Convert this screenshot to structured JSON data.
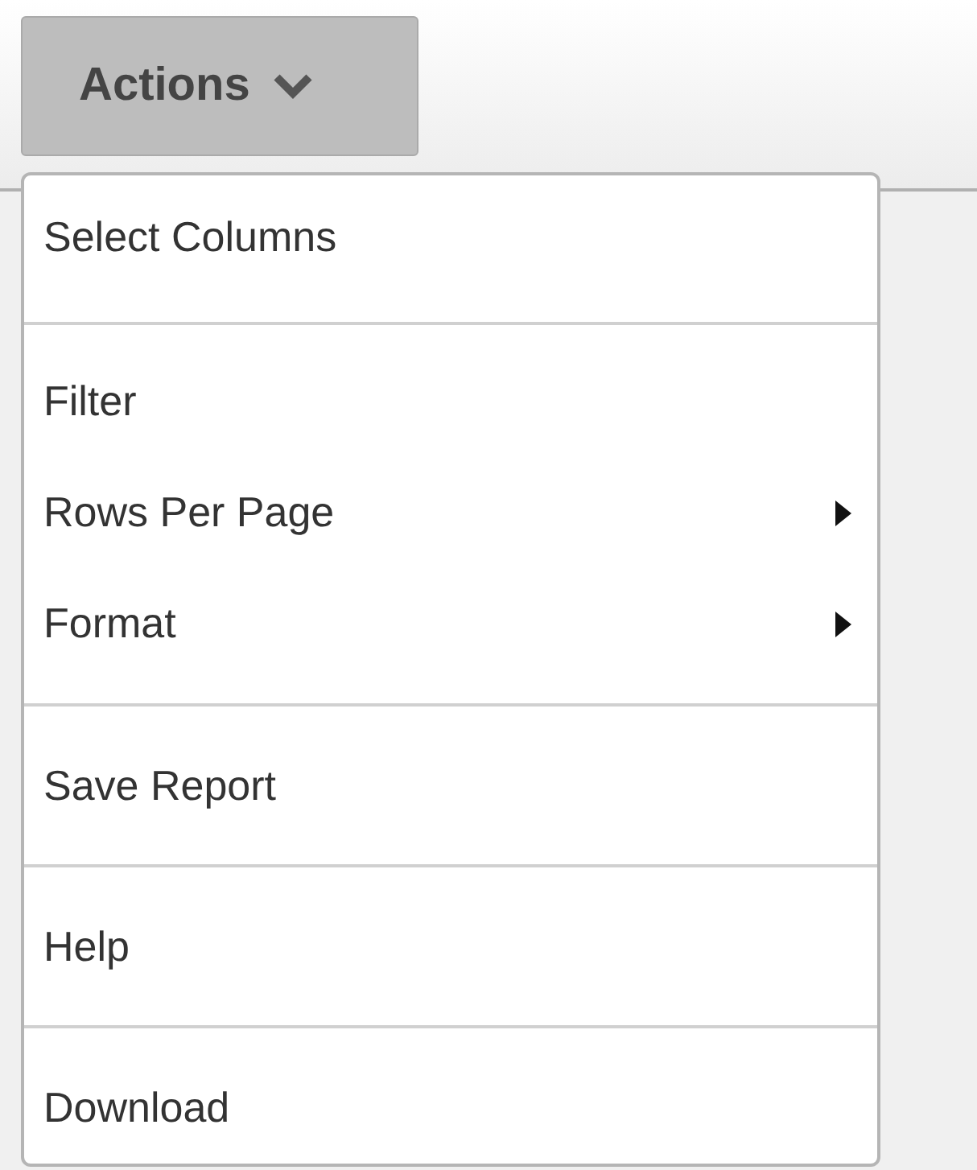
{
  "actions_button": {
    "label": "Actions"
  },
  "menu": {
    "groups": [
      {
        "items": [
          {
            "label": "Select Columns",
            "kind": "action"
          }
        ]
      },
      {
        "items": [
          {
            "label": "Filter",
            "kind": "action"
          },
          {
            "label": "Rows Per Page",
            "kind": "submenu"
          },
          {
            "label": "Format",
            "kind": "submenu"
          }
        ]
      },
      {
        "items": [
          {
            "label": "Save Report",
            "kind": "action"
          }
        ]
      },
      {
        "items": [
          {
            "label": "Help",
            "kind": "action"
          }
        ]
      },
      {
        "items": [
          {
            "label": "Download",
            "kind": "action"
          }
        ]
      }
    ]
  }
}
